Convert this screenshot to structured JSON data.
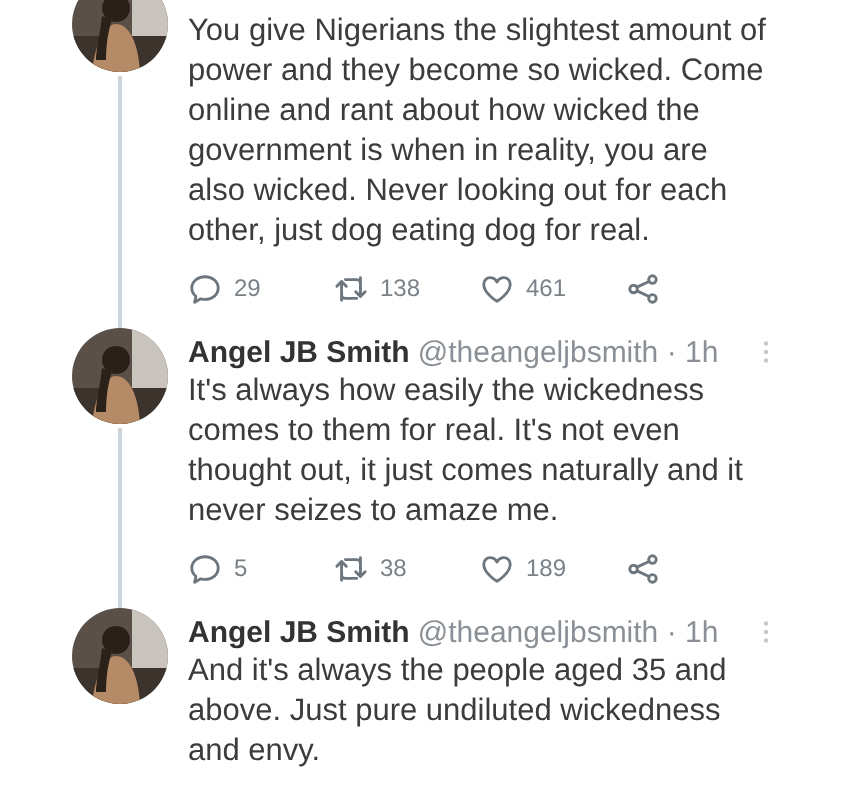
{
  "tweets": [
    {
      "text": "You give Nigerians the slightest amount of power and they become so wicked. Come online and rant about how wicked the government is when in reality, you are also wicked. Never looking out for each other, just dog eating dog for real.",
      "replies": "29",
      "retweets": "138",
      "likes": "461"
    },
    {
      "name": "Angel JB Smith",
      "handle": "@theangeljbsmith · 1h",
      "text": "It's always how easily the wickedness comes to them for real. It's not even thought out, it just comes naturally and it never seizes to amaze me.",
      "replies": "5",
      "retweets": "38",
      "likes": "189"
    },
    {
      "name": "Angel JB Smith",
      "handle": "@theangeljbsmith · 1h",
      "text": "And it's always the people aged 35 and above. Just pure undiluted wickedness and envy."
    }
  ]
}
